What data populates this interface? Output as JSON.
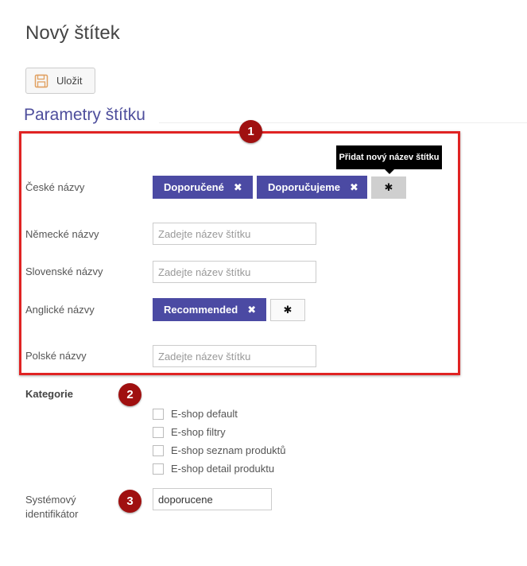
{
  "page": {
    "title": "Nový štítek",
    "save_label": "Uložit",
    "section_title": "Parametry štítku"
  },
  "badges": [
    "1",
    "2",
    "3"
  ],
  "tooltip": "Přidat nový název štítku",
  "names": {
    "czech": {
      "label": "České názvy",
      "tags": [
        "Doporučené",
        "Doporučujeme"
      ],
      "remove_symbol": "✖",
      "add_symbol": "✱"
    },
    "german": {
      "label": "Německé názvy",
      "placeholder": "Zadejte název štítku"
    },
    "slovak": {
      "label": "Slovenské názvy",
      "placeholder": "Zadejte název štítku"
    },
    "english": {
      "label": "Anglické názvy",
      "tags": [
        "Recommended"
      ],
      "remove_symbol": "✖",
      "add_symbol": "✱"
    },
    "polish": {
      "label": "Polské názvy",
      "placeholder": "Zadejte název štítku"
    }
  },
  "categories": {
    "label": "Kategorie",
    "items": [
      {
        "label": "E-shop default",
        "checked": false
      },
      {
        "label": "E-shop filtry",
        "checked": false
      },
      {
        "label": "E-shop seznam produktů",
        "checked": false
      },
      {
        "label": "E-shop detail produktu",
        "checked": false
      }
    ]
  },
  "system_id": {
    "label_line1": "Systémový",
    "label_line2": "identifikátor",
    "value": "doporucene"
  },
  "icons": {
    "save": "floppy-disk-icon",
    "remove": "close-icon",
    "add": "asterisk-icon"
  },
  "colors": {
    "tag_bg": "#4b4aa3",
    "section_title": "#4e4e9c",
    "highlight_border": "#e02323",
    "badge_bg": "#a01010"
  }
}
